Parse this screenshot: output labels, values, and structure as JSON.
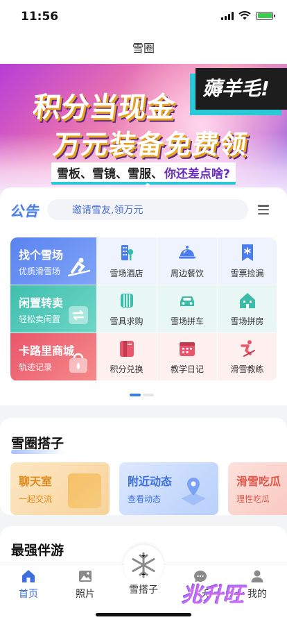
{
  "status_bar": {
    "time": "11:56"
  },
  "nav": {
    "title": "雪圈"
  },
  "banner": {
    "line1": "积分当现金",
    "line2": "万元装备免费领",
    "tag": "薅羊毛!",
    "strip_items": "雪板、雪镜、雪服、",
    "strip_highlight": "你还差点啥?"
  },
  "notice": {
    "label": "公告",
    "search_text": "邀请雪友,领万元"
  },
  "feature_grid": {
    "big": [
      {
        "title": "找个雪场",
        "subtitle": "优质滑雪场"
      },
      {
        "title": "闲置转卖",
        "subtitle": "轻松卖闲置"
      },
      {
        "title": "卡路里商城",
        "subtitle": "轨迹记录"
      }
    ],
    "items": [
      {
        "label": "雪场酒店",
        "icon": "hotel-icon",
        "color": "#4a7ef0"
      },
      {
        "label": "周边餐饮",
        "icon": "food-cloche-icon",
        "color": "#4a7ef0"
      },
      {
        "label": "雪票捡漏",
        "icon": "ticket-icon",
        "color": "#4a7ef0"
      },
      {
        "label": "雪具求购",
        "icon": "ski-gear-icon",
        "color": "#3bbca9"
      },
      {
        "label": "雪场拼车",
        "icon": "car-icon",
        "color": "#3bbca9"
      },
      {
        "label": "雪场拼房",
        "icon": "house-icon",
        "color": "#3bbca9"
      },
      {
        "label": "积分兑换",
        "icon": "gift-book-icon",
        "color": "#e9566b"
      },
      {
        "label": "教学日记",
        "icon": "calendar-icon",
        "color": "#e9566b"
      },
      {
        "label": "滑雪教练",
        "icon": "skier-icon",
        "color": "#e9566b"
      }
    ]
  },
  "section_snow": {
    "title": "雪圈搭子",
    "tiles": [
      {
        "title": "聊天室",
        "subtitle": "一起交流"
      },
      {
        "title": "附近动态",
        "subtitle": "查看动态"
      },
      {
        "title": "滑雪吃瓜",
        "subtitle": "理性吃瓜"
      }
    ]
  },
  "section_partner": {
    "title": "最强伴游"
  },
  "tabbar": {
    "tabs": [
      {
        "label": "首页",
        "icon": "home-icon"
      },
      {
        "label": "照片",
        "icon": "photo-icon"
      },
      {
        "label": "雪搭子",
        "icon": "snowflake-icon"
      },
      {
        "label": "聊天",
        "icon": "chat-icon"
      },
      {
        "label": "我的",
        "icon": "user-icon"
      }
    ]
  },
  "watermark": "兆升旺"
}
